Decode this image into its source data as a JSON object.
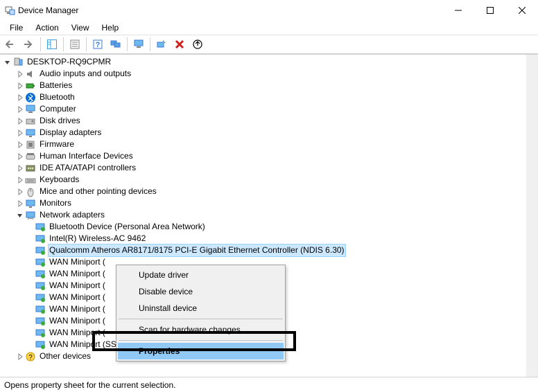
{
  "window": {
    "title": "Device Manager"
  },
  "menubar": {
    "items": [
      "File",
      "Action",
      "View",
      "Help"
    ]
  },
  "toolbar": {
    "back": "back",
    "forward": "forward",
    "show_hide": "show-hide",
    "properties": "properties",
    "help": "help",
    "monitors": "monitors",
    "computer": "computer",
    "scan": "scan",
    "delete": "delete",
    "update": "update"
  },
  "tree": {
    "root": {
      "label": "DESKTOP-RQ9CPMR"
    },
    "categories": [
      {
        "label": "Audio inputs and outputs",
        "icon": "speaker",
        "expanded": false
      },
      {
        "label": "Batteries",
        "icon": "battery",
        "expanded": false
      },
      {
        "label": "Bluetooth",
        "icon": "bluetooth",
        "expanded": false
      },
      {
        "label": "Computer",
        "icon": "computer",
        "expanded": false
      },
      {
        "label": "Disk drives",
        "icon": "disk",
        "expanded": false
      },
      {
        "label": "Display adapters",
        "icon": "display",
        "expanded": false
      },
      {
        "label": "Firmware",
        "icon": "firmware",
        "expanded": false
      },
      {
        "label": "Human Interface Devices",
        "icon": "hid",
        "expanded": false
      },
      {
        "label": "IDE ATA/ATAPI controllers",
        "icon": "ide",
        "expanded": false
      },
      {
        "label": "Keyboards",
        "icon": "keyboard",
        "expanded": false
      },
      {
        "label": "Mice and other pointing devices",
        "icon": "mouse",
        "expanded": false
      },
      {
        "label": "Monitors",
        "icon": "monitor",
        "expanded": false
      },
      {
        "label": "Network adapters",
        "icon": "network",
        "expanded": true,
        "children": [
          {
            "label": "Bluetooth Device (Personal Area Network)"
          },
          {
            "label": "Intel(R) Wireless-AC 9462"
          },
          {
            "label": "Qualcomm Atheros AR8171/8175 PCI-E Gigabit Ethernet Controller (NDIS 6.30)",
            "selected": true
          },
          {
            "label": "WAN Miniport ("
          },
          {
            "label": "WAN Miniport ("
          },
          {
            "label": "WAN Miniport ("
          },
          {
            "label": "WAN Miniport ("
          },
          {
            "label": "WAN Miniport ("
          },
          {
            "label": "WAN Miniport ("
          },
          {
            "label": "WAN Miniport ("
          },
          {
            "label": "WAN Miniport (SSTP)"
          }
        ]
      },
      {
        "label": "Other devices",
        "icon": "other",
        "expanded": false
      }
    ]
  },
  "context_menu": {
    "items": {
      "update": "Update driver",
      "disable": "Disable device",
      "uninstall": "Uninstall device",
      "scan": "Scan for hardware changes",
      "properties": "Properties"
    },
    "highlighted": "properties"
  },
  "statusbar": {
    "text": "Opens property sheet for the current selection."
  }
}
